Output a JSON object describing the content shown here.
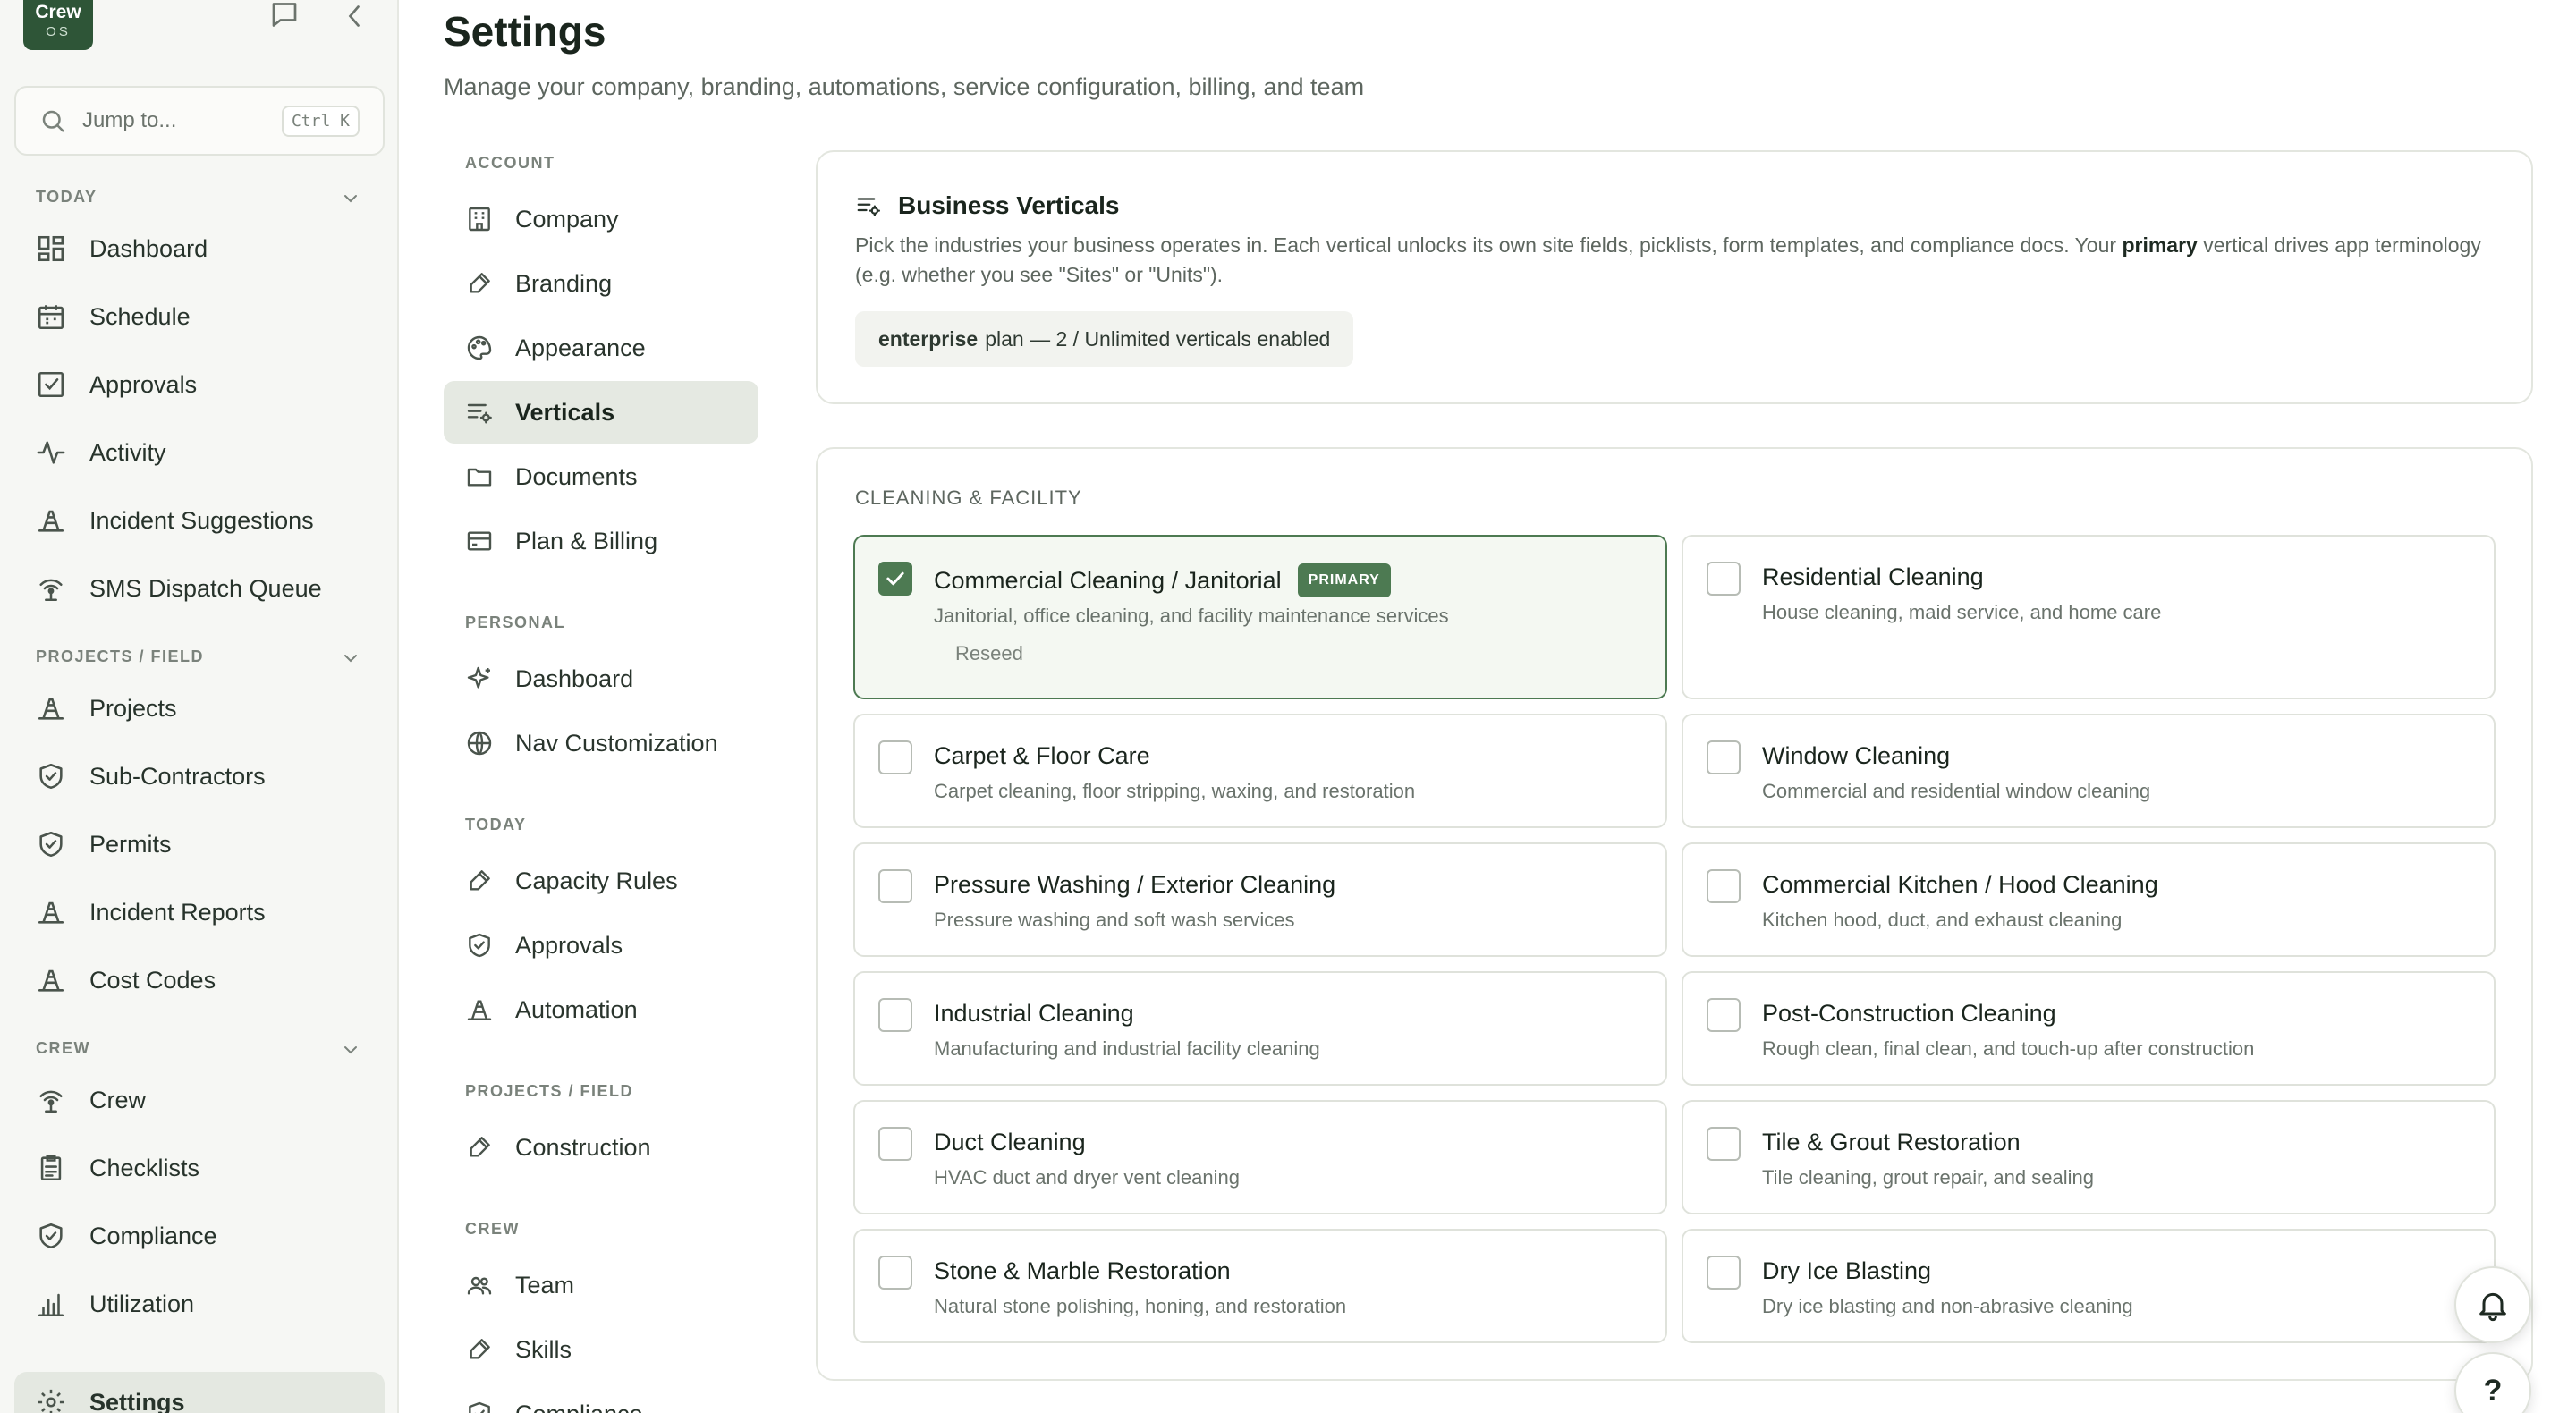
{
  "app": {
    "logo_line1": "Crew",
    "logo_line2": "OS",
    "accent_color": "#4d7a52",
    "brand_color": "#2e5537"
  },
  "jump": {
    "placeholder": "Jump to...",
    "shortcut": "Ctrl K"
  },
  "sidebar": {
    "sections": [
      {
        "label": "TODAY",
        "items": [
          {
            "label": "Dashboard",
            "icon": "dashboard-icon"
          },
          {
            "label": "Schedule",
            "icon": "calendar-icon"
          },
          {
            "label": "Approvals",
            "icon": "check-square-icon"
          },
          {
            "label": "Activity",
            "icon": "activity-icon"
          },
          {
            "label": "Incident Suggestions",
            "icon": "cone-icon"
          },
          {
            "label": "SMS Dispatch Queue",
            "icon": "broadcast-icon"
          }
        ]
      },
      {
        "label": "PROJECTS / FIELD",
        "items": [
          {
            "label": "Projects",
            "icon": "cone-icon"
          },
          {
            "label": "Sub-Contractors",
            "icon": "shield-icon"
          },
          {
            "label": "Permits",
            "icon": "shield-icon"
          },
          {
            "label": "Incident Reports",
            "icon": "cone-icon"
          },
          {
            "label": "Cost Codes",
            "icon": "cone-icon"
          }
        ]
      },
      {
        "label": "CREW",
        "items": [
          {
            "label": "Crew",
            "icon": "broadcast-icon"
          },
          {
            "label": "Checklists",
            "icon": "clipboard-icon"
          },
          {
            "label": "Compliance",
            "icon": "shield-icon"
          },
          {
            "label": "Utilization",
            "icon": "bar-chart-icon"
          }
        ]
      }
    ],
    "settings": {
      "label": "Settings",
      "icon": "gear-icon"
    }
  },
  "page": {
    "title": "Settings",
    "subtitle": "Manage your company, branding, automations, service configuration, billing, and team"
  },
  "settings_nav": {
    "sections": [
      {
        "label": "ACCOUNT",
        "items": [
          {
            "label": "Company",
            "icon": "building-icon"
          },
          {
            "label": "Branding",
            "icon": "brush-icon"
          },
          {
            "label": "Appearance",
            "icon": "palette-icon"
          },
          {
            "label": "Verticals",
            "icon": "list-settings-icon",
            "active": true
          },
          {
            "label": "Documents",
            "icon": "folder-icon"
          },
          {
            "label": "Plan & Billing",
            "icon": "card-icon"
          }
        ]
      },
      {
        "label": "PERSONAL",
        "items": [
          {
            "label": "Dashboard",
            "icon": "sparkle-icon"
          },
          {
            "label": "Nav Customization",
            "icon": "globe-icon"
          }
        ]
      },
      {
        "label": "TODAY",
        "items": [
          {
            "label": "Capacity Rules",
            "icon": "wrench-icon"
          },
          {
            "label": "Approvals",
            "icon": "shield-icon"
          },
          {
            "label": "Automation",
            "icon": "cone-icon"
          }
        ]
      },
      {
        "label": "PROJECTS / FIELD",
        "items": [
          {
            "label": "Construction",
            "icon": "wrench-icon"
          }
        ]
      },
      {
        "label": "CREW",
        "items": [
          {
            "label": "Team",
            "icon": "users-icon"
          },
          {
            "label": "Skills",
            "icon": "wrench-icon"
          },
          {
            "label": "Compliance",
            "icon": "shield-icon"
          }
        ]
      }
    ]
  },
  "verticals_card": {
    "title": "Business Verticals",
    "desc_part1": "Pick the industries your business operates in. Each vertical unlocks its own site fields, picklists, form templates, and compliance docs. Your ",
    "desc_bold": "primary",
    "desc_part2": " vertical drives app terminology (e.g. whether you see \"Sites\" or \"Units\").",
    "plan_name": "enterprise",
    "plan_text": "plan — 2 / Unlimited verticals enabled"
  },
  "category": {
    "label": "CLEANING & FACILITY",
    "primary_badge": "PRIMARY",
    "reseed_label": "Reseed",
    "tiles": [
      {
        "title": "Commercial Cleaning / Janitorial",
        "desc": "Janitorial, office cleaning, and facility maintenance services",
        "checked": true,
        "primary": true
      },
      {
        "title": "Residential Cleaning",
        "desc": "House cleaning, maid service, and home care",
        "checked": false
      },
      {
        "title": "Carpet & Floor Care",
        "desc": "Carpet cleaning, floor stripping, waxing, and restoration",
        "checked": false
      },
      {
        "title": "Window Cleaning",
        "desc": "Commercial and residential window cleaning",
        "checked": false
      },
      {
        "title": "Pressure Washing / Exterior Cleaning",
        "desc": "Pressure washing and soft wash services",
        "checked": false
      },
      {
        "title": "Commercial Kitchen / Hood Cleaning",
        "desc": "Kitchen hood, duct, and exhaust cleaning",
        "checked": false
      },
      {
        "title": "Industrial Cleaning",
        "desc": "Manufacturing and industrial facility cleaning",
        "checked": false
      },
      {
        "title": "Post-Construction Cleaning",
        "desc": "Rough clean, final clean, and touch-up after construction",
        "checked": false
      },
      {
        "title": "Duct Cleaning",
        "desc": "HVAC duct and dryer vent cleaning",
        "checked": false
      },
      {
        "title": "Tile & Grout Restoration",
        "desc": "Tile cleaning, grout repair, and sealing",
        "checked": false
      },
      {
        "title": "Stone & Marble Restoration",
        "desc": "Natural stone polishing, honing, and restoration",
        "checked": false
      },
      {
        "title": "Dry Ice Blasting",
        "desc": "Dry ice blasting and non-abrasive cleaning",
        "checked": false
      }
    ]
  },
  "floating": {
    "help_label": "?"
  }
}
